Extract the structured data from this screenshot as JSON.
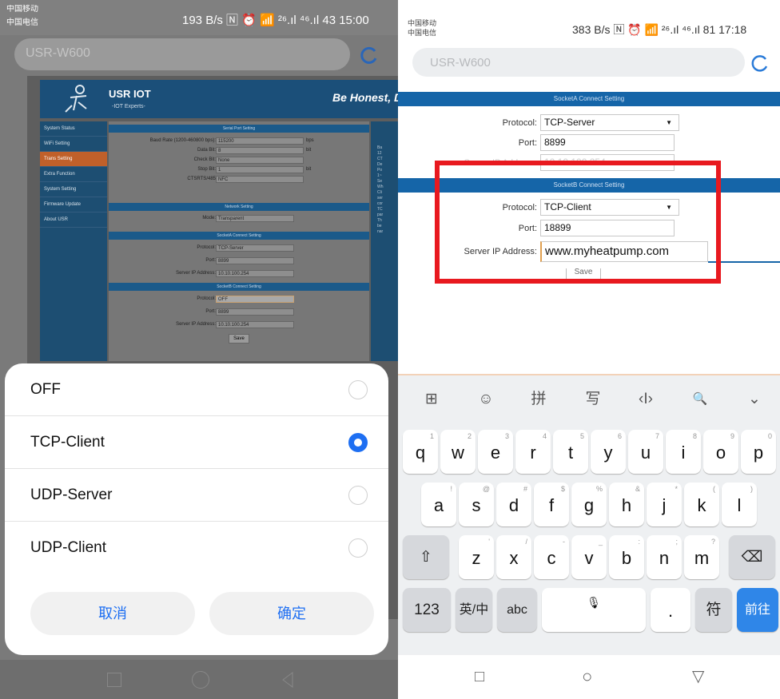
{
  "left_phone": {
    "status": {
      "carrier1": "中国移动",
      "carrier2": "中国电信",
      "right": "193 B/s 🄽 ⏰ 📶 ²⁶.ıl ⁴⁶.ıl 43 15:00"
    },
    "url": "USR-W600",
    "page": {
      "brand": "USR IOT",
      "brand_sub": "-IOT Experts-",
      "slogan": "Be Honest, D",
      "menu": [
        "System Status",
        "WiFi Setting",
        "Trans Setting",
        "Extra Function",
        "System Setting",
        "Firmware Update",
        "About USR"
      ],
      "serial_title": "Serial Port Setting",
      "serial_rows": [
        {
          "label": "Baud Rate (1200-460800 bps):",
          "value": "115200",
          "unit": "bps"
        },
        {
          "label": "Data Bit:",
          "value": "8",
          "unit": "bit"
        },
        {
          "label": "Check Bit:",
          "value": "None",
          "unit": ""
        },
        {
          "label": "Stop Bit:",
          "value": "1",
          "unit": "bit"
        },
        {
          "label": "CTSRTS/485",
          "value": "NFC",
          "unit": ""
        }
      ],
      "network_title": "Network Setting",
      "mode_label": "Mode:",
      "mode_value": "Transparent",
      "socketA_title": "SocketA Connect Setting",
      "socketA": [
        {
          "label": "Protocol:",
          "value": "TCP-Server"
        },
        {
          "label": "Port:",
          "value": "8899"
        },
        {
          "label": "Server IP Address:",
          "value": "10.10.100.254"
        }
      ],
      "socketB_title": "SocketB Connect Setting",
      "socketB": [
        {
          "label": "Protocol:",
          "value": "OFF"
        },
        {
          "label": "Port:",
          "value": "8899"
        },
        {
          "label": "Server IP Address:",
          "value": "10.10.100.254"
        }
      ],
      "save": "Save",
      "info": [
        "Ba",
        "12",
        "CT",
        "De",
        "Po",
        "1~",
        "Se",
        "Wh",
        "Cli",
        "ser",
        "cor",
        "TC",
        "par",
        "Th",
        "be",
        "nar"
      ]
    },
    "dialog": {
      "options": [
        {
          "label": "OFF",
          "selected": false
        },
        {
          "label": "TCP-Client",
          "selected": true
        },
        {
          "label": "UDP-Server",
          "selected": false
        },
        {
          "label": "UDP-Client",
          "selected": false
        }
      ],
      "cancel": "取消",
      "confirm": "确定"
    }
  },
  "right_phone": {
    "status": {
      "carrier1": "中国移动",
      "carrier2": "中国电信",
      "right": "383 B/s 🄽 ⏰ 📶 ²⁶.ıl ⁴⁶.ıl 81 17:18"
    },
    "url": "USR-W600",
    "socketA_title": "SocketA Connect Setting",
    "socketA": {
      "protocol_label": "Protocol:",
      "protocol_value": "TCP-Server",
      "port_label": "Port:",
      "port_value": "8899",
      "ip_label": "Server IP Address:",
      "ip_value": "10.10.100.254"
    },
    "socketB_title": "SocketB Connect Setting",
    "socketB": {
      "protocol_label": "Protocol:",
      "protocol_value": "TCP-Client",
      "port_label": "Port:",
      "port_value": "18899",
      "ip_label": "Server IP Address:",
      "ip_value": "www.myheatpump.com"
    },
    "save": "Save",
    "highlight_color": "#e8191f",
    "keyboard": {
      "toolbar": [
        "⊞",
        "☺",
        "拼",
        "写",
        "‹I›",
        "🔍",
        "⌄"
      ],
      "row1": [
        {
          "k": "q",
          "s": "1"
        },
        {
          "k": "w",
          "s": "2"
        },
        {
          "k": "e",
          "s": "3"
        },
        {
          "k": "r",
          "s": "4"
        },
        {
          "k": "t",
          "s": "5"
        },
        {
          "k": "y",
          "s": "6"
        },
        {
          "k": "u",
          "s": "7"
        },
        {
          "k": "i",
          "s": "8"
        },
        {
          "k": "o",
          "s": "9"
        },
        {
          "k": "p",
          "s": "0"
        }
      ],
      "row2": [
        {
          "k": "a",
          "s": "!"
        },
        {
          "k": "s",
          "s": "@"
        },
        {
          "k": "d",
          "s": "#"
        },
        {
          "k": "f",
          "s": "$"
        },
        {
          "k": "g",
          "s": "%"
        },
        {
          "k": "h",
          "s": "&"
        },
        {
          "k": "j",
          "s": "*"
        },
        {
          "k": "k",
          "s": "("
        },
        {
          "k": "l",
          "s": ")"
        }
      ],
      "row3": [
        {
          "k": "z",
          "s": "'"
        },
        {
          "k": "x",
          "s": "/"
        },
        {
          "k": "c",
          "s": "-"
        },
        {
          "k": "v",
          "s": "_"
        },
        {
          "k": "b",
          "s": ":"
        },
        {
          "k": "n",
          "s": ";"
        },
        {
          "k": "m",
          "s": "?"
        }
      ],
      "shift": "⇧",
      "backspace": "⌫",
      "num": "123",
      "lang": "英/中",
      "abc": "abc",
      "mic": "🎙",
      "punct": ".",
      "sym": "符",
      "go": "前往"
    },
    "nav": {
      "recent": "□",
      "home": "○",
      "back": "▽"
    }
  }
}
